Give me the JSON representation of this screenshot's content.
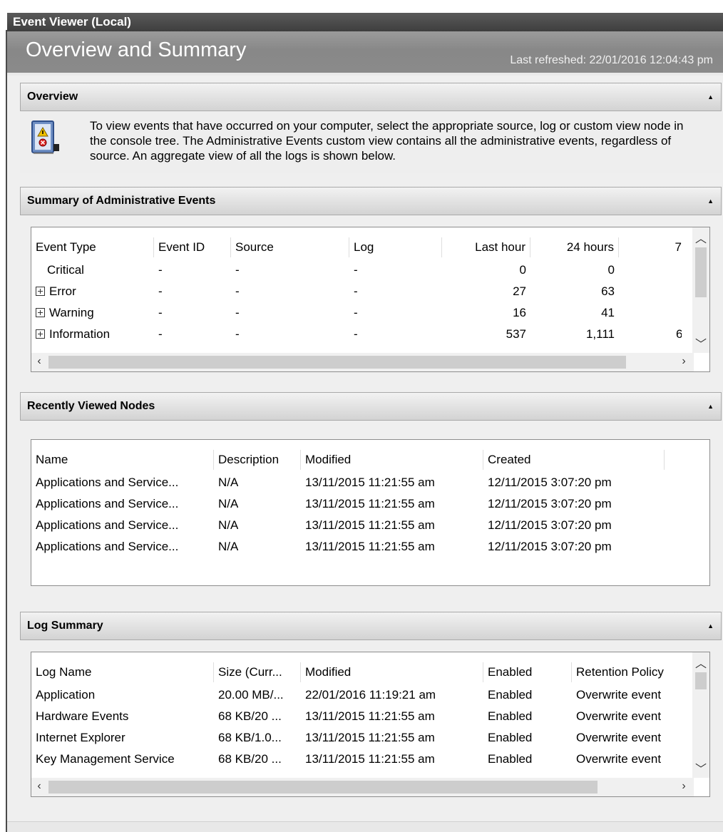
{
  "window": {
    "title": "Event Viewer (Local)"
  },
  "header": {
    "title": "Overview and Summary",
    "last_refreshed": "Last refreshed: 22/01/2016 12:04:43 pm"
  },
  "overview": {
    "label": "Overview",
    "text": "To view events that have occurred on your computer, select the appropriate source, log or custom view node in the console tree. The Administrative Events custom view contains all the administrative events, regardless of source. An aggregate view of all the logs is shown below."
  },
  "admin_summary": {
    "label": "Summary of Administrative Events",
    "columns": [
      "Event Type",
      "Event ID",
      "Source",
      "Log",
      "Last hour",
      "24 hours",
      "7"
    ],
    "rows": [
      {
        "type": "Critical",
        "expandable": false,
        "event_id": "-",
        "source": "-",
        "log": "-",
        "last_hour": "0",
        "h24": "0",
        "d7": ""
      },
      {
        "type": "Error",
        "expandable": true,
        "event_id": "-",
        "source": "-",
        "log": "-",
        "last_hour": "27",
        "h24": "63",
        "d7": ""
      },
      {
        "type": "Warning",
        "expandable": true,
        "event_id": "-",
        "source": "-",
        "log": "-",
        "last_hour": "16",
        "h24": "41",
        "d7": ""
      },
      {
        "type": "Information",
        "expandable": true,
        "event_id": "-",
        "source": "-",
        "log": "-",
        "last_hour": "537",
        "h24": "1,111",
        "d7": "6"
      }
    ]
  },
  "recent_nodes": {
    "label": "Recently Viewed Nodes",
    "columns": [
      "Name",
      "Description",
      "Modified",
      "Created"
    ],
    "rows": [
      {
        "name": "Applications and Service...",
        "description": "N/A",
        "modified": "13/11/2015 11:21:55 am",
        "created": "12/11/2015 3:07:20 pm"
      },
      {
        "name": "Applications and Service...",
        "description": "N/A",
        "modified": "13/11/2015 11:21:55 am",
        "created": "12/11/2015 3:07:20 pm"
      },
      {
        "name": "Applications and Service...",
        "description": "N/A",
        "modified": "13/11/2015 11:21:55 am",
        "created": "12/11/2015 3:07:20 pm"
      },
      {
        "name": "Applications and Service...",
        "description": "N/A",
        "modified": "13/11/2015 11:21:55 am",
        "created": "12/11/2015 3:07:20 pm"
      }
    ]
  },
  "log_summary": {
    "label": "Log Summary",
    "columns": [
      "Log Name",
      "Size (Curr...",
      "Modified",
      "Enabled",
      "Retention Policy"
    ],
    "rows": [
      {
        "name": "Application",
        "size": "20.00 MB/...",
        "modified": "22/01/2016 11:19:21 am",
        "enabled": "Enabled",
        "retention": "Overwrite event"
      },
      {
        "name": "Hardware Events",
        "size": "68 KB/20 ...",
        "modified": "13/11/2015 11:21:55 am",
        "enabled": "Enabled",
        "retention": "Overwrite event"
      },
      {
        "name": "Internet Explorer",
        "size": "68 KB/1.0...",
        "modified": "13/11/2015 11:21:55 am",
        "enabled": "Enabled",
        "retention": "Overwrite event"
      },
      {
        "name": "Key Management Service",
        "size": "68 KB/20 ...",
        "modified": "13/11/2015 11:21:55 am",
        "enabled": "Enabled",
        "retention": "Overwrite event"
      }
    ]
  },
  "icons": {
    "collapse": "collapse-up-icon",
    "expand": "plus-box-icon",
    "log_book": "event-log-book-icon",
    "scroll_up": "scroll-up-arrow-icon",
    "scroll_down": "scroll-down-arrow-icon",
    "scroll_left": "scroll-left-arrow-icon",
    "scroll_right": "scroll-right-arrow-icon"
  },
  "colors": {
    "titlebar": "#4a4a4a",
    "summary_header": "#8f8f8f",
    "panel_background": "#efefef",
    "section_bar": "#dcdcdc"
  }
}
